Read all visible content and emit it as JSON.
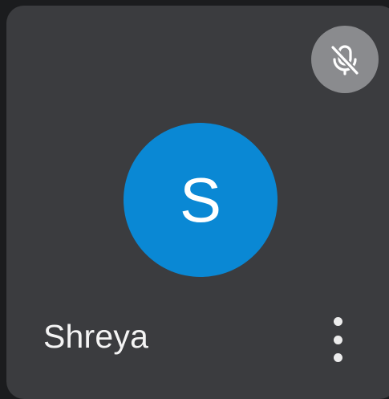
{
  "participant": {
    "name": "Shreya",
    "initial": "S",
    "muted": true,
    "avatar_color": "#0a88d4"
  },
  "icons": {
    "mute": "microphone-off-icon",
    "more": "more-vertical-icon"
  },
  "colors": {
    "tile_background": "#3b3c3f",
    "mute_badge_background": "#8a8b8e"
  }
}
